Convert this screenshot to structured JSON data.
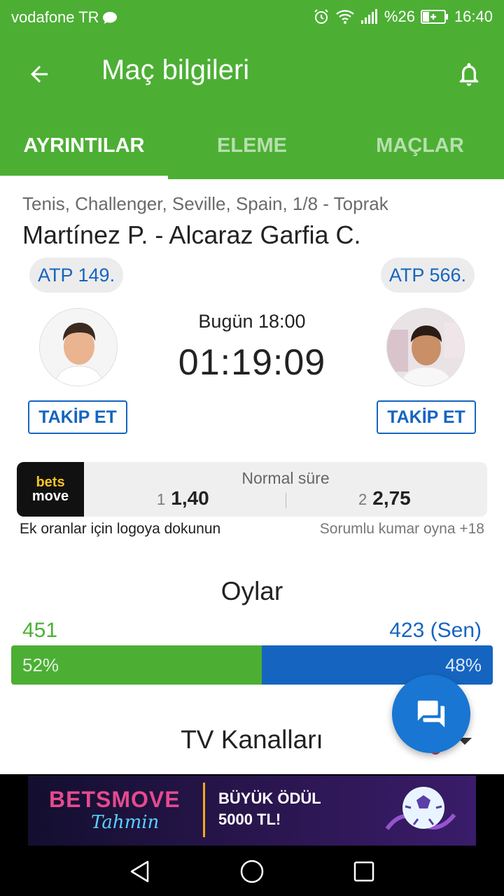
{
  "status_bar": {
    "carrier": "vodafone TR",
    "battery": "%26",
    "time": "16:40"
  },
  "app_bar": {
    "title": "Maç bilgileri"
  },
  "tabs": [
    {
      "label": "AYRINTILAR",
      "active": true
    },
    {
      "label": "ELEME",
      "active": false
    },
    {
      "label": "MAÇLAR",
      "active": false
    }
  ],
  "match": {
    "competition": "Tenis, Challenger, Seville, Spain, 1/8 - Toprak",
    "title": "Martínez P. - Alcaraz Garfia C.",
    "player1": {
      "rank": "ATP 149.",
      "follow_label": "TAKİP ET"
    },
    "player2": {
      "rank": "ATP 566.",
      "follow_label": "TAKİP ET"
    },
    "kickoff": "Bugün 18:00",
    "countdown": "01:19:09"
  },
  "odds": {
    "logo_line1": "bets",
    "logo_line2": "move",
    "label": "Normal süre",
    "home_index": "1",
    "home_value": "1,40",
    "away_index": "2",
    "away_value": "2,75",
    "hint": "Ek oranlar için logoya dokunun",
    "responsible": "Sorumlu kumar oyna +18"
  },
  "votes": {
    "title": "Oylar",
    "left_count": "451",
    "right_count": "423 (Sen)",
    "left_percent_label": "52%",
    "right_percent_label": "48%",
    "left_fraction": 0.52
  },
  "tv": {
    "title": "TV Kanalları"
  },
  "banner": {
    "brand": "BETSMOVE",
    "sub": "Tahmin",
    "line1": "BÜYÜK ÖDÜL",
    "line2": "5000 TL!"
  },
  "colors": {
    "primary_green": "#4caf34",
    "primary_blue": "#1565c0",
    "fab_blue": "#1976d2"
  }
}
